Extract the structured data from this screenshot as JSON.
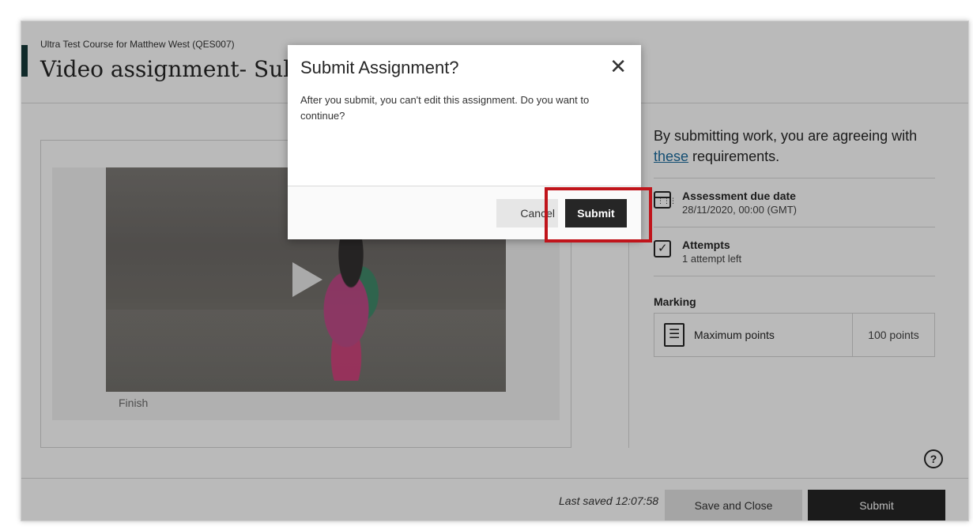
{
  "header": {
    "course_name": "Ultra Test Course for Matthew West (QES007)",
    "page_title": "Video assignment- Sub"
  },
  "video": {
    "caption": "Finish"
  },
  "sidebar": {
    "agree_prefix": "By submitting work, you are agreeing with ",
    "agree_link": "these",
    "agree_suffix": " requirements.",
    "due_date": {
      "title": "Assessment due date",
      "value": "28/11/2020, 00:00 (GMT)",
      "icon": "calendar-icon"
    },
    "attempts": {
      "title": "Attempts",
      "value": "1 attempt left",
      "icon": "checkbox-icon"
    },
    "marking": {
      "title": "Marking",
      "label": "Maximum points",
      "points": "100 points",
      "icon": "rubric-icon"
    }
  },
  "footer": {
    "last_saved": "Last saved 12:07:58",
    "save_close_label": "Save and Close",
    "submit_label": "Submit"
  },
  "modal": {
    "title": "Submit Assignment?",
    "body": "After you submit, you can't edit this assignment. Do you want to continue?",
    "cancel_label": "Cancel",
    "submit_label": "Submit",
    "close_icon": "close-icon"
  },
  "help": {
    "icon": "help-icon",
    "glyph": "?"
  },
  "colors": {
    "highlight": "#c0141b",
    "primary_button": "#262626",
    "link": "#1b6b9e",
    "accent_bar": "#163a3a"
  }
}
